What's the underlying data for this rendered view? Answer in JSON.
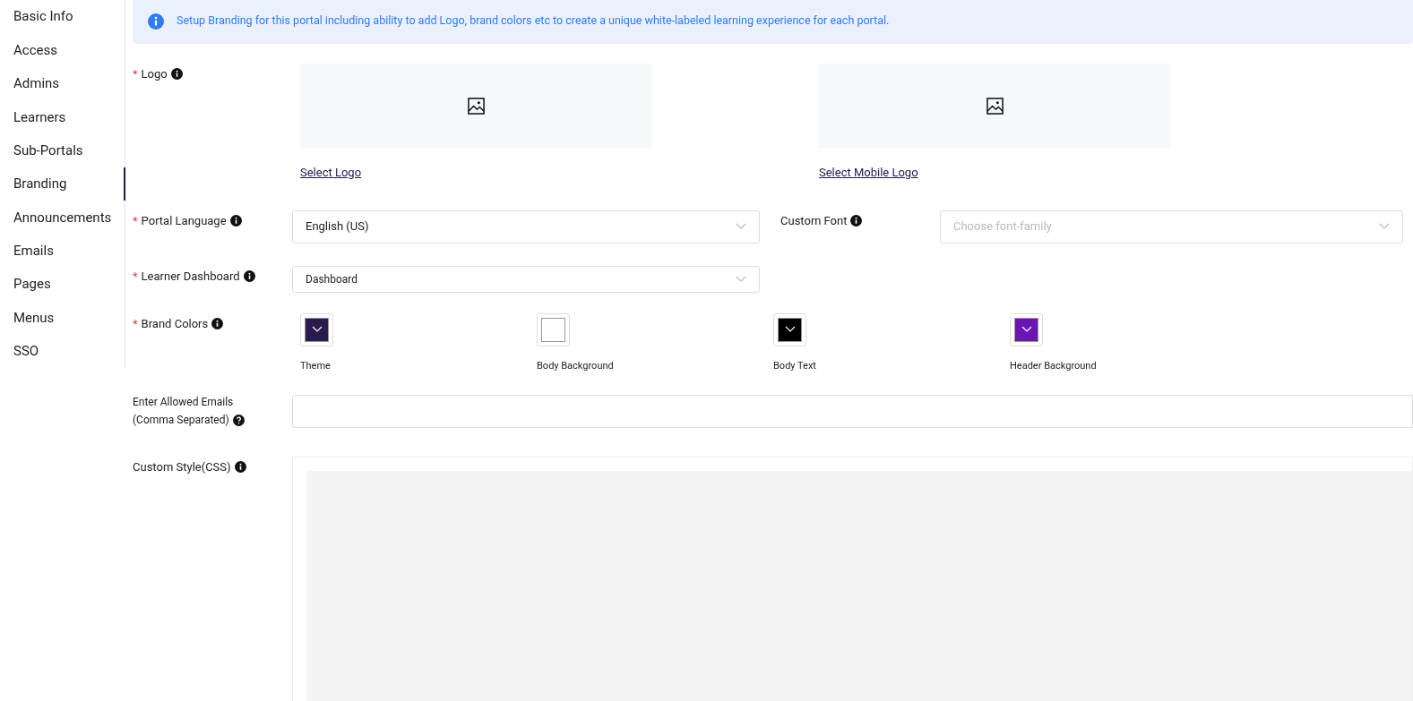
{
  "sidebar": {
    "items": [
      {
        "label": "Basic Info",
        "selected": false
      },
      {
        "label": "Access",
        "selected": false
      },
      {
        "label": "Admins",
        "selected": false
      },
      {
        "label": "Learners",
        "selected": false
      },
      {
        "label": "Sub-Portals",
        "selected": false
      },
      {
        "label": "Branding",
        "selected": true
      },
      {
        "label": "Announcements",
        "selected": false
      },
      {
        "label": "Emails",
        "selected": false
      },
      {
        "label": "Pages",
        "selected": false
      },
      {
        "label": "Menus",
        "selected": false
      },
      {
        "label": "SSO",
        "selected": false
      }
    ]
  },
  "banner": {
    "text": "Setup Branding for this portal including ability to add Logo, brand colors etc to create a unique white-labeled learning experience for each portal."
  },
  "logo": {
    "required_mark": "*",
    "label": "Logo",
    "uploads": [
      {
        "link": "Select Logo"
      },
      {
        "link": "Select Mobile Logo"
      }
    ]
  },
  "portal_language": {
    "required_mark": "*",
    "label": "Portal Language",
    "value": "English (US)"
  },
  "custom_font": {
    "label": "Custom Font",
    "placeholder": "Choose font-family"
  },
  "learner_dashboard": {
    "required_mark": "*",
    "label": "Learner Dashboard",
    "value": "Dashboard"
  },
  "brand_colors": {
    "required_mark": "*",
    "label": "Brand Colors",
    "colors": [
      {
        "name": "Theme",
        "color": "#2a1b4e"
      },
      {
        "name": "Body Background",
        "color": "#ffffff"
      },
      {
        "name": "Body Text",
        "color": "#000000"
      },
      {
        "name": "Header Background",
        "color": "#6a16b4"
      }
    ]
  },
  "allowed_emails": {
    "label_lines": [
      "Enter Allowed Emails",
      "(Comma Separated)"
    ]
  },
  "custom_style": {
    "label": "Custom Style(CSS)"
  }
}
